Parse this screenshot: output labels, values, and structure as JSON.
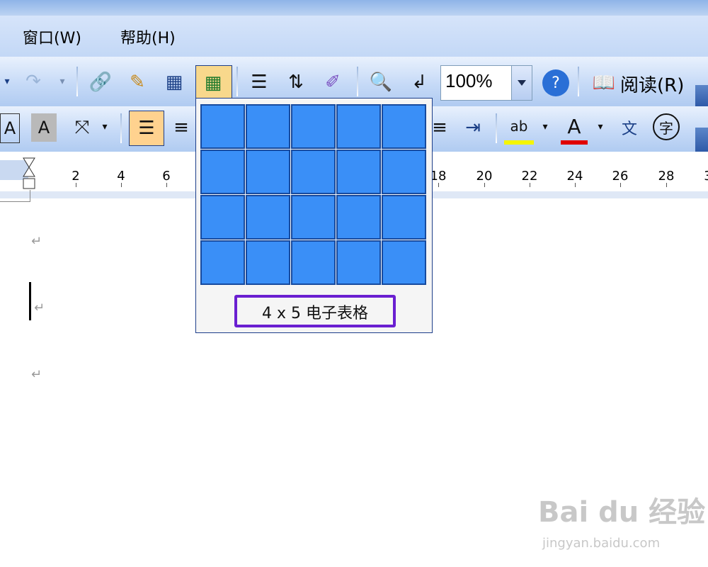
{
  "menu": {
    "window_label": "窗口(W)",
    "help_label": "帮助(H)"
  },
  "toolbar": {
    "zoom_value": "100%",
    "read_label": "阅读(R)",
    "icons": [
      "undo-icon",
      "redo-icon",
      "hyperlink-icon",
      "tables-borders-icon",
      "insert-table-icon",
      "insert-excel-sheet-icon",
      "columns-icon",
      "drawing-icon",
      "show-hide-icon",
      "document-map-icon",
      "zoom-dropdown",
      "help-icon",
      "read-icon"
    ]
  },
  "format_toolbar": {
    "icons": [
      "char-border-icon",
      "char-shading-icon",
      "text-direction-icon",
      "justify-icon",
      "center-icon",
      "decrease-indent-icon",
      "increase-indent-icon",
      "highlight-icon",
      "font-color-icon",
      "phonetic-guide-icon",
      "enclose-char-icon"
    ]
  },
  "ruler": {
    "ticks": [
      "2",
      "4",
      "6",
      "18",
      "20",
      "22",
      "24",
      "26",
      "28",
      "3"
    ]
  },
  "grid_popup": {
    "rows": 4,
    "cols": 5,
    "label": "4 x 5 电子表格"
  },
  "watermark": {
    "main": "Bai du 经验",
    "sub": "jingyan.baidu.com"
  },
  "colors": {
    "cell_fill": "#3a8ff7",
    "highlight_border": "#6a1fd1",
    "toolbar": "#c6daf7"
  }
}
